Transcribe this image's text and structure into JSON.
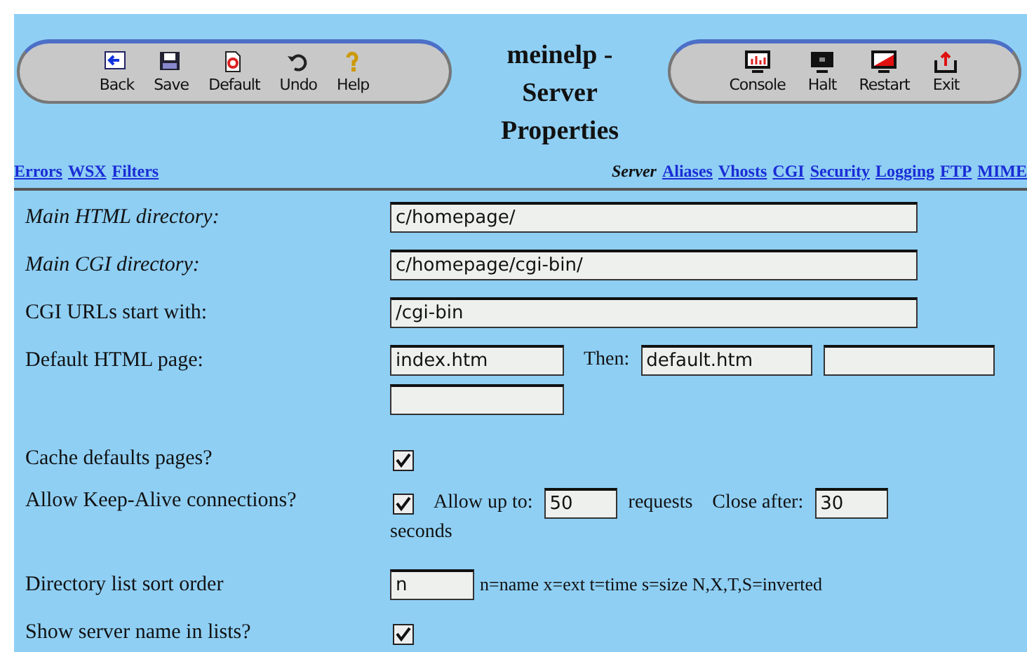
{
  "title": "meinelp - Server Properties",
  "left_toolbar": [
    {
      "label": "Back"
    },
    {
      "label": "Save"
    },
    {
      "label": "Default"
    },
    {
      "label": "Undo"
    },
    {
      "label": "Help"
    }
  ],
  "right_toolbar": [
    {
      "label": "Console"
    },
    {
      "label": "Halt"
    },
    {
      "label": "Restart"
    },
    {
      "label": "Exit"
    }
  ],
  "left_links": [
    "Errors",
    "WSX",
    "Filters"
  ],
  "server_label": "Server",
  "server_links": [
    "Aliases",
    "Vhosts",
    "CGI",
    "Security",
    "Logging",
    "FTP",
    "MIME"
  ],
  "rows": [
    {
      "kind": "text",
      "label": "Main HTML directory:",
      "emphasized": true,
      "value": "c/homepage/"
    },
    {
      "kind": "text",
      "label": "Main CGI directory:",
      "emphasized": true,
      "value": "c/homepage/cgi-bin/"
    },
    {
      "kind": "text",
      "label": "CGI URLs start with:",
      "emphasized": false,
      "value": "/cgi-bin"
    },
    {
      "kind": "default_page",
      "label": "Default HTML page:",
      "value": "index.htm",
      "then_label": "Then:",
      "then_value": "default.htm"
    },
    {
      "kind": "checkbox",
      "label": "Cache defaults pages?",
      "checked": true
    },
    {
      "kind": "keepalive",
      "label": "Allow Keep-Alive connections?",
      "checked": true,
      "allow_label": "Allow up to:",
      "allow_value": "50",
      "requests_label": "requests",
      "close_label": "Close after:",
      "close_value": "30",
      "seconds_label": "seconds"
    },
    {
      "kind": "sort",
      "label": "Directory list sort order",
      "value": "n",
      "hint": "n=name x=ext t=time s=size N,X,T,S=inverted"
    },
    {
      "kind": "checkbox",
      "label": "Show server name in lists?",
      "checked": true
    }
  ]
}
